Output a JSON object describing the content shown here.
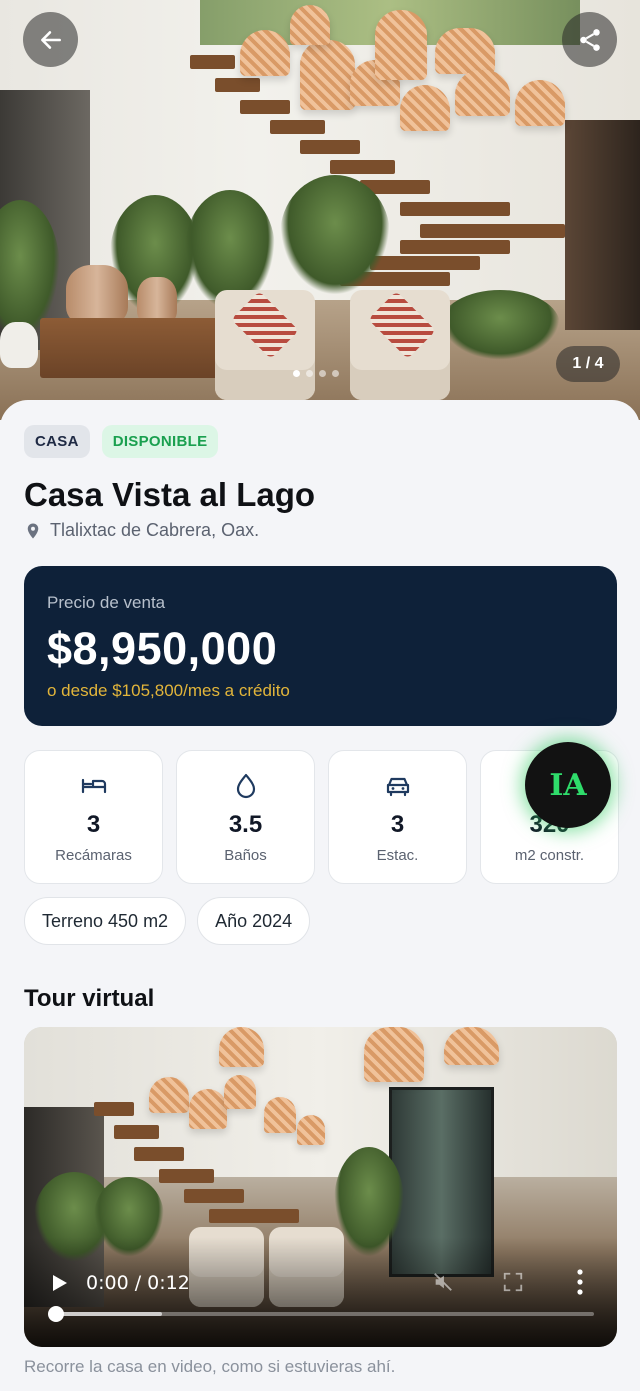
{
  "hero": {
    "counter": "1 / 4",
    "dots": [
      true,
      false,
      false,
      false
    ]
  },
  "icons": {
    "back": "arrow-left-icon",
    "share": "share-icon",
    "location": "map-pin-icon"
  },
  "property": {
    "type_badge": "CASA",
    "status_badge": "DISPONIBLE",
    "title": "Casa Vista al Lago",
    "location": "Tlalixtac de Cabrera, Oax."
  },
  "price": {
    "label": "Precio de venta",
    "value": "$8,950,000",
    "credit": "o desde $105,800/mes a crédito"
  },
  "features": [
    {
      "icon": "bed-icon",
      "value": "3",
      "label": "Recámaras"
    },
    {
      "icon": "water-drop-icon",
      "value": "3.5",
      "label": "Baños"
    },
    {
      "icon": "car-icon",
      "value": "3",
      "label": "Estac."
    },
    {
      "icon": "expand-arrows-icon",
      "value": "320",
      "label": "m2 constr."
    }
  ],
  "chips": [
    "Terreno 450 m2",
    "Año 2024"
  ],
  "tour": {
    "title": "Tour virtual",
    "time": "0:00 / 0:12",
    "progress": 0,
    "buffered": 0.2,
    "caption": "Recorre la casa en video, como si estuvieras ahí."
  },
  "assistant": {
    "label": "IA"
  },
  "colors": {
    "price_card": "#0e2139",
    "credit_accent": "#e2b53a",
    "status_green": "#1aa04f",
    "assistant_glow": "#2fdc6b"
  }
}
